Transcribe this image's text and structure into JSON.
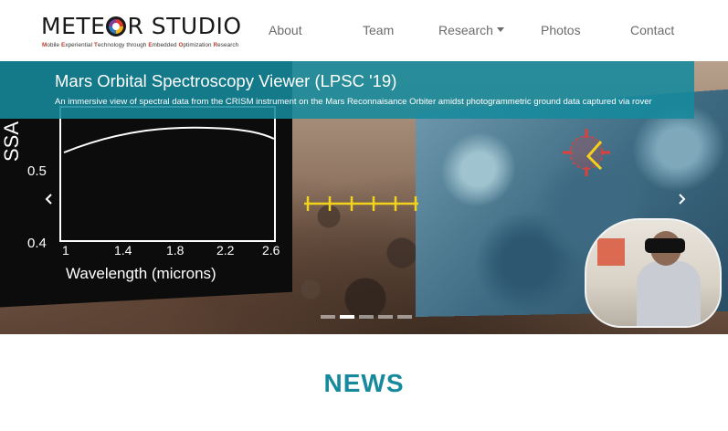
{
  "brand": {
    "title_left": "METE",
    "title_right": "R STUDIO",
    "subtitle_parts": [
      {
        "b": "M",
        "t": "obile "
      },
      {
        "b": "E",
        "t": "xperiential "
      },
      {
        "b": "T",
        "t": "echnology through "
      },
      {
        "b": "E",
        "t": "mbedded "
      },
      {
        "b": "O",
        "t": "ptimization "
      },
      {
        "b": "R",
        "t": "esearch"
      }
    ]
  },
  "nav": {
    "about": "About",
    "team": "Team",
    "research": "Research",
    "photos": "Photos",
    "contact": "Contact"
  },
  "carousel": {
    "title": "Mars Orbital Spectroscopy Viewer (LPSC '19)",
    "description": "An immersive view of spectral data from the CRISM instrument on the Mars Reconnaisance Orbiter amidst photogrammetric ground data captured via rover",
    "slide_count": 5,
    "active_index": 1,
    "prev_icon": "chevron-left-icon",
    "next_icon": "chevron-right-icon",
    "graph": {
      "ylabel": "SSA",
      "yticks": [
        "0.5",
        "0.4"
      ],
      "xticks": [
        "1",
        "1.4",
        "1.8",
        "2.2",
        "2.6"
      ],
      "xlabel": "Wavelength (microns)"
    }
  },
  "news": {
    "heading": "NEWS"
  },
  "colors": {
    "accent": "#168a9c",
    "caption_bg": "#168a9c"
  }
}
